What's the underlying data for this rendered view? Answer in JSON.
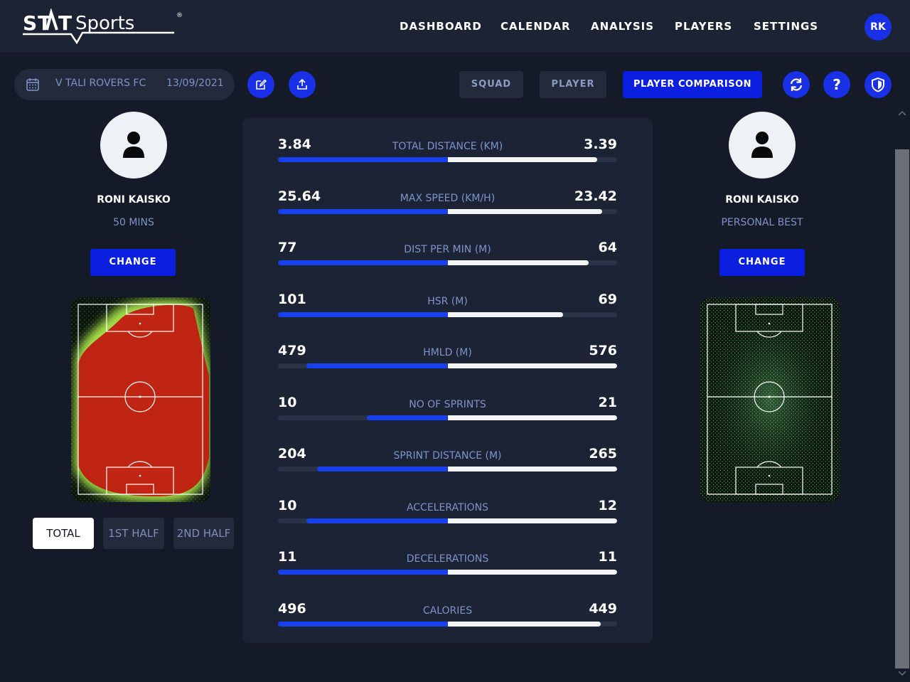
{
  "header": {
    "brand": "STATSports",
    "nav": [
      "DASHBOARD",
      "CALENDAR",
      "ANALYSIS",
      "PLAYERS",
      "SETTINGS"
    ],
    "user_initials": "RK"
  },
  "toolbar": {
    "match_name": "V TALI ROVERS FC",
    "match_date": "13/09/2021",
    "views": [
      "SQUAD",
      "PLAYER",
      "PLAYER COMPARISON"
    ],
    "active_view": "PLAYER COMPARISON",
    "icons": [
      "calendar-icon",
      "edit-icon",
      "share-icon",
      "refresh-icon",
      "help-icon",
      "shield-icon"
    ]
  },
  "left_player": {
    "name": "RONI KAISKO",
    "subtitle": "50 MINS",
    "change_label": "CHANGE",
    "heatmap": "full-red"
  },
  "right_player": {
    "name": "RONI KAISKO",
    "subtitle": "PERSONAL BEST",
    "change_label": "CHANGE",
    "heatmap": "speckled-green"
  },
  "periods": [
    "TOTAL",
    "1ST HALF",
    "2ND HALF"
  ],
  "active_period": "TOTAL",
  "colors": {
    "accent": "#0b1fe0",
    "bar_left": "#1741ee",
    "bar_right": "#f3f4f6",
    "label": "#7d93c9"
  },
  "stats": [
    {
      "label": "TOTAL DISTANCE (KM)",
      "left": "3.84",
      "right": "3.39",
      "left_val": 3.84,
      "right_val": 3.39
    },
    {
      "label": "MAX SPEED (KM/H)",
      "left": "25.64",
      "right": "23.42",
      "left_val": 25.64,
      "right_val": 23.42
    },
    {
      "label": "DIST PER MIN (M)",
      "left": "77",
      "right": "64",
      "left_val": 77,
      "right_val": 64
    },
    {
      "label": "HSR (M)",
      "left": "101",
      "right": "69",
      "left_val": 101,
      "right_val": 69
    },
    {
      "label": "HMLD (M)",
      "left": "479",
      "right": "576",
      "left_val": 479,
      "right_val": 576
    },
    {
      "label": "NO OF SPRINTS",
      "left": "10",
      "right": "21",
      "left_val": 10,
      "right_val": 21
    },
    {
      "label": "SPRINT DISTANCE (M)",
      "left": "204",
      "right": "265",
      "left_val": 204,
      "right_val": 265
    },
    {
      "label": "ACCELERATIONS",
      "left": "10",
      "right": "12",
      "left_val": 10,
      "right_val": 12
    },
    {
      "label": "DECELERATIONS",
      "left": "11",
      "right": "11",
      "left_val": 11,
      "right_val": 11
    },
    {
      "label": "CALORIES",
      "left": "496",
      "right": "449",
      "left_val": 496,
      "right_val": 449
    }
  ]
}
